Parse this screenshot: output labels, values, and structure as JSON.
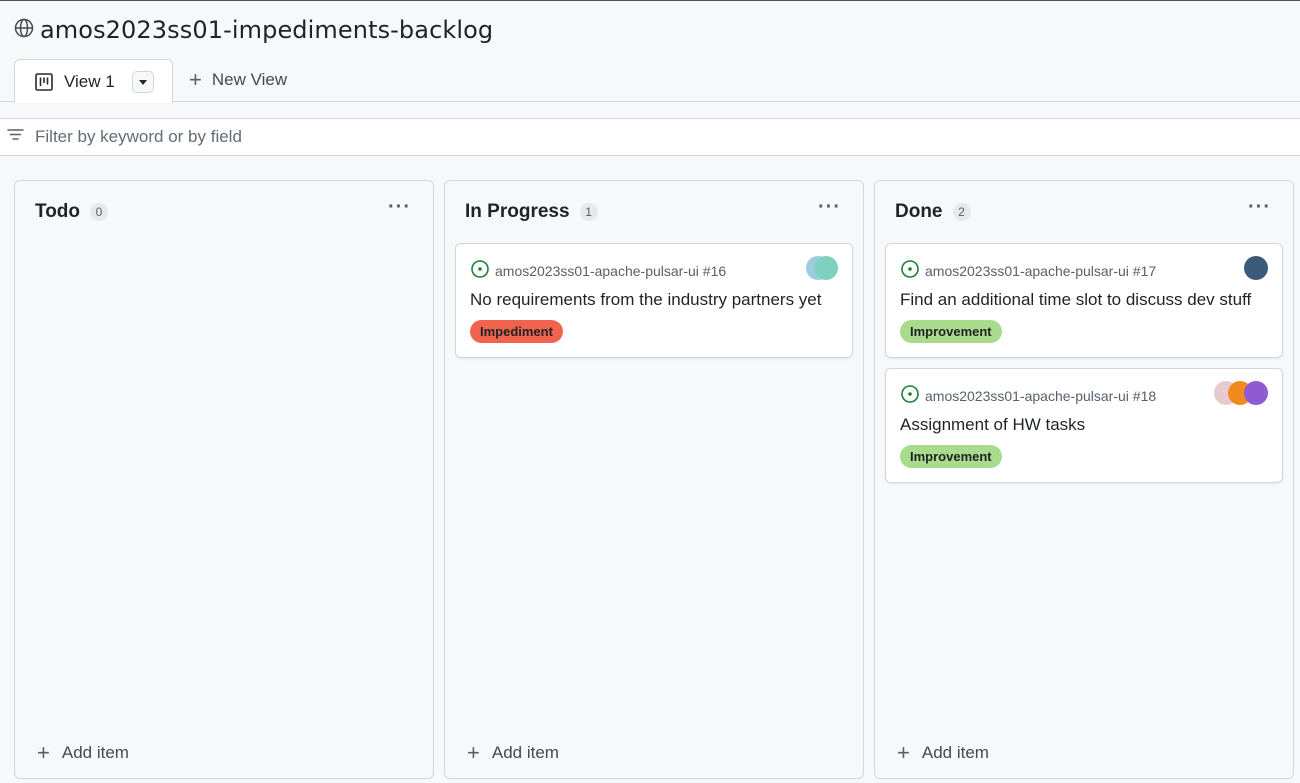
{
  "project": {
    "title": "amos2023ss01-impediments-backlog"
  },
  "tabs": {
    "active_label": "View 1",
    "new_view_label": "New View"
  },
  "filter": {
    "placeholder": "Filter by keyword or by field"
  },
  "columns": [
    {
      "title": "Todo",
      "count": "0",
      "add_item_label": "Add item",
      "cards": []
    },
    {
      "title": "In Progress",
      "count": "1",
      "add_item_label": "Add item",
      "cards": [
        {
          "repo": "amos2023ss01-apache-pulsar-ui #16",
          "title": "No requirements from the industry partners yet",
          "label": "Impediment",
          "label_color": "#f0634d"
        }
      ]
    },
    {
      "title": "Done",
      "count": "2",
      "add_item_label": "Add item",
      "cards": [
        {
          "repo": "amos2023ss01-apache-pulsar-ui #17",
          "title": "Find an additional time slot to discuss dev stuff",
          "label": "Improvement",
          "label_color": "#a8db8c"
        },
        {
          "repo": "amos2023ss01-apache-pulsar-ui #18",
          "title": "Assignment of HW tasks",
          "label": "Improvement",
          "label_color": "#a8db8c"
        }
      ]
    }
  ],
  "colors": {
    "open_issue": "#1a7f37",
    "border": "#d0d7de",
    "background": "#f6f8fa"
  },
  "icons": {
    "title": "globe-icon",
    "tab": "board-icon",
    "filter": "filter-icon",
    "issue": "issue-opened-icon"
  }
}
